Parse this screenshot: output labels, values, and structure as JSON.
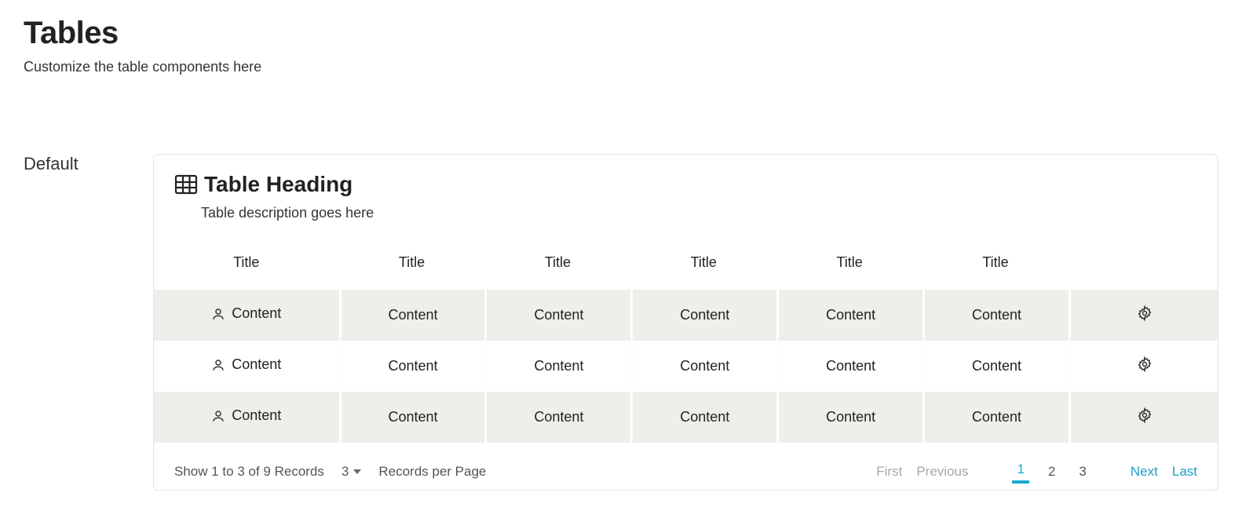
{
  "page": {
    "title": "Tables",
    "subtitle": "Customize the table components here"
  },
  "section": {
    "label": "Default"
  },
  "card": {
    "title": "Table Heading",
    "description": "Table description goes here"
  },
  "table": {
    "headers": [
      "Title",
      "Title",
      "Title",
      "Title",
      "Title",
      "Title"
    ],
    "rows": [
      [
        "Content",
        "Content",
        "Content",
        "Content",
        "Content",
        "Content"
      ],
      [
        "Content",
        "Content",
        "Content",
        "Content",
        "Content",
        "Content"
      ],
      [
        "Content",
        "Content",
        "Content",
        "Content",
        "Content",
        "Content"
      ]
    ]
  },
  "footer": {
    "summary": "Show 1 to 3 of 9 Records",
    "per_page_value": "3",
    "per_page_label": "Records per Page",
    "pagination": {
      "first": "First",
      "previous": "Previous",
      "pages": [
        "1",
        "2",
        "3"
      ],
      "active_page": "1",
      "next": "Next",
      "last": "Last"
    }
  }
}
